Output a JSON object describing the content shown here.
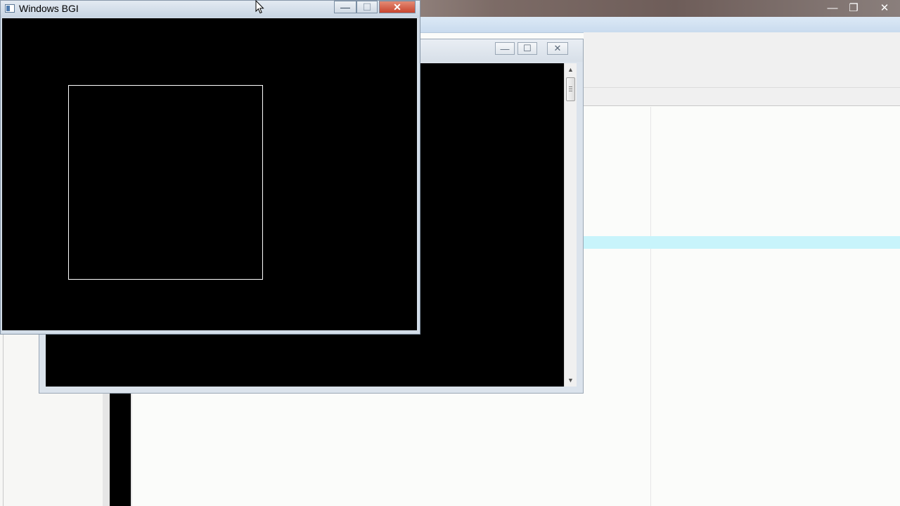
{
  "bgi_window": {
    "title": "Windows BGI",
    "minimize_glyph": "—",
    "maximize_glyph": "☐",
    "close_glyph": "✕"
  },
  "ide_window": {
    "minimize_glyph": "—",
    "restore_glyph": "❐",
    "close_glyph": "✕"
  },
  "console_window": {
    "minimize_glyph": "—",
    "maximize_glyph": "☐",
    "close_glyph": "✕",
    "scroll_up_glyph": "▲",
    "scroll_down_glyph": "▼"
  },
  "colors": {
    "bgi_canvas": "#000000",
    "square_stroke": "#ffffff",
    "bgi_close": "#c8452f",
    "line_highlight": "#c8f4fb"
  },
  "icons": {
    "bgi": "app-window-icon",
    "cursor": "mouse-pointer-icon"
  }
}
